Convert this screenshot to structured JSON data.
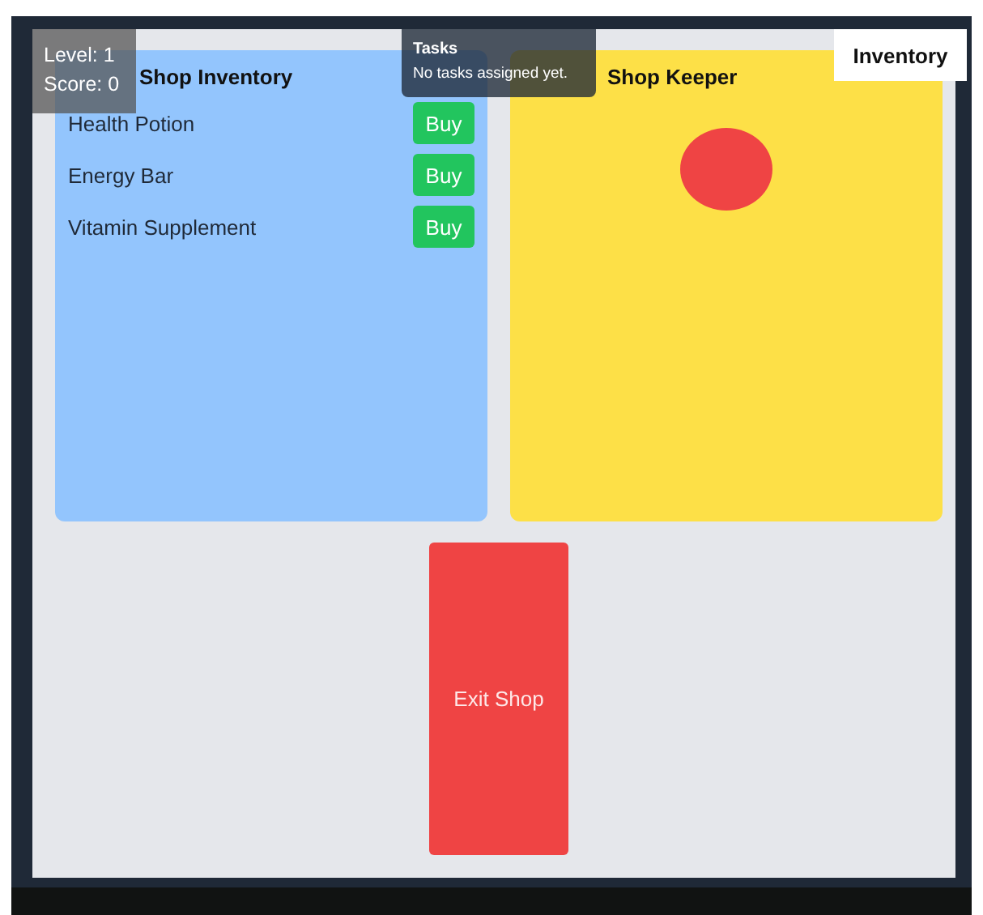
{
  "hud": {
    "level": "Level: 1",
    "score": "Score: 0"
  },
  "tasks": {
    "title": "Tasks",
    "message": "No tasks assigned yet."
  },
  "inventory_button": "Inventory",
  "shop_inventory": {
    "title": "Shop Inventory",
    "items": [
      {
        "name": "Health Potion",
        "action": "Buy"
      },
      {
        "name": "Energy Bar",
        "action": "Buy"
      },
      {
        "name": "Vitamin Supplement",
        "action": "Buy"
      }
    ]
  },
  "shop_keeper": {
    "title": "Shop Keeper"
  },
  "exit_button": "Exit Shop"
}
